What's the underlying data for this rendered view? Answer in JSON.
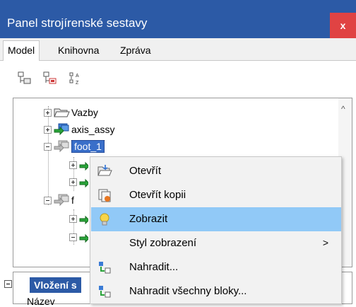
{
  "window": {
    "title": "Panel strojírenské sestavy",
    "close_label": "x"
  },
  "tabs": [
    {
      "label": "Model",
      "active": true
    },
    {
      "label": "Knihovna",
      "active": false
    },
    {
      "label": "Zpráva",
      "active": false
    }
  ],
  "tree": {
    "items": [
      {
        "label": "Vazby",
        "icon": "folder-icon",
        "expander": "plus"
      },
      {
        "label": "axis_assy",
        "icon": "assembly-icon",
        "expander": "plus"
      },
      {
        "label": "foot_1",
        "icon": "assembly-icon",
        "expander": "minus",
        "selected": true
      },
      {
        "label": "f",
        "icon": "assembly-icon",
        "expander": "minus"
      }
    ]
  },
  "context_menu": {
    "items": [
      {
        "label": "Otevřít",
        "icon": "open-icon"
      },
      {
        "label": "Otevřít kopii",
        "icon": "open-copy-icon"
      },
      {
        "label": "Zobrazit",
        "icon": "lightbulb-icon",
        "highlighted": true
      },
      {
        "label": "Styl zobrazení",
        "icon": "",
        "submenu_glyph": ">"
      },
      {
        "label": "Nahradit...",
        "icon": "replace-icon"
      },
      {
        "label": "Nahradit všechny bloky...",
        "icon": "replace-all-icon"
      }
    ]
  },
  "properties": {
    "section_label": "Vložení s",
    "first_row_label": "Název"
  },
  "scrollbar": {
    "up_glyph": "^"
  }
}
